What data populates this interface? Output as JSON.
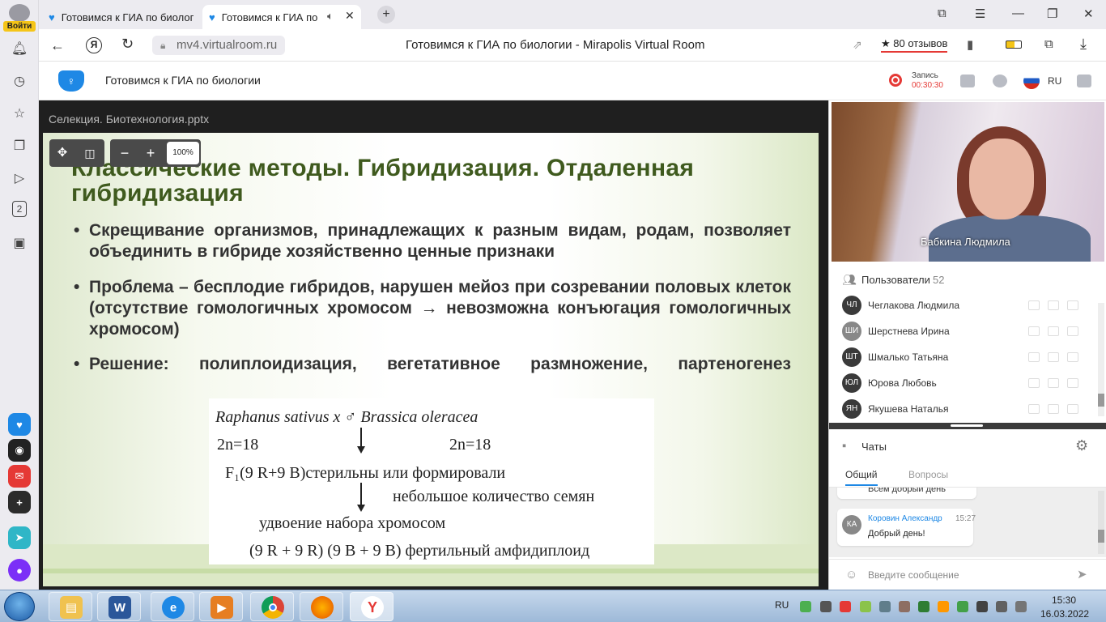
{
  "browser": {
    "login_badge": "Войти",
    "tabs": [
      {
        "title": "Готовимся к ГИА по биолог",
        "active": false,
        "icon": "heart-icon"
      },
      {
        "title": "Готовимся к ГИА по",
        "active": true,
        "icon": "heart-icon"
      }
    ],
    "url": "mv4.virtualroom.ru",
    "page_title": "Готовимся к ГИА по биологии - Mirapolis Virtual Room",
    "reviews": "★ 80 отзывов",
    "side_badge": "2"
  },
  "app": {
    "title": "Готовимся к ГИА по биологии",
    "record_label": "Запись",
    "record_time": "00:30:30",
    "language": "RU"
  },
  "presentation": {
    "filename": "Селекция. Биотехнология.pptx",
    "zoom": "100%",
    "slide": {
      "title": "Классические методы. Гибридизация. Отдаленная гибридизация",
      "bullets": [
        "Скрещивание организмов, принадлежащих к разным видам, родам, позволяет объединить в гибриде хозяйственно ценные признаки",
        "Проблема – бесплодие гибридов, нарушен мейоз при созревании половых клеток (отсутствие гомологичных хромосом → невозможна конъюгация гомологичных хромосом)",
        "Решение: полиплоидизация, вегетативное размножение, партеногенез"
      ],
      "diagram": {
        "cross": "Raphanus sativus x ♂ Brassica oleracea",
        "left_chrom": "2n=18",
        "right_chrom": "2n=18",
        "f1": "F₁(9 R+9 B)стерильны или формировали",
        "f1_cont": "небольшое количество семян",
        "doubling": "удвоение набора хромосом",
        "result": "(9 R + 9 R) (9 B + 9 B) фертильный амфидиплоид"
      }
    }
  },
  "video": {
    "speaker": "Бабкина Людмила"
  },
  "users": {
    "title": "Пользователи",
    "count": "52",
    "list": [
      {
        "initials": "ЧЛ",
        "name": "Чеглакова Людмила"
      },
      {
        "initials": "ШИ",
        "name": "Шерстнева Ирина"
      },
      {
        "initials": "ШТ",
        "name": "Шмалько Татьяна"
      },
      {
        "initials": "ЮЛ",
        "name": "Юрова Любовь"
      },
      {
        "initials": "ЯН",
        "name": "Якушева Наталья"
      }
    ]
  },
  "chat": {
    "title": "Чаты",
    "tabs": [
      "Общий",
      "Вопросы"
    ],
    "prev_message": "Всем добрый день",
    "message": {
      "initials": "КА",
      "author": "Коровин Александр",
      "time": "15:27",
      "text": "Добрый день!"
    },
    "placeholder": "Введите сообщение"
  },
  "taskbar": {
    "language": "RU",
    "time": "15:30",
    "date": "16.03.2022"
  },
  "colors": {
    "accent": "#1e88e5",
    "slide_title": "#3f5a1e",
    "record": "#e53935"
  }
}
